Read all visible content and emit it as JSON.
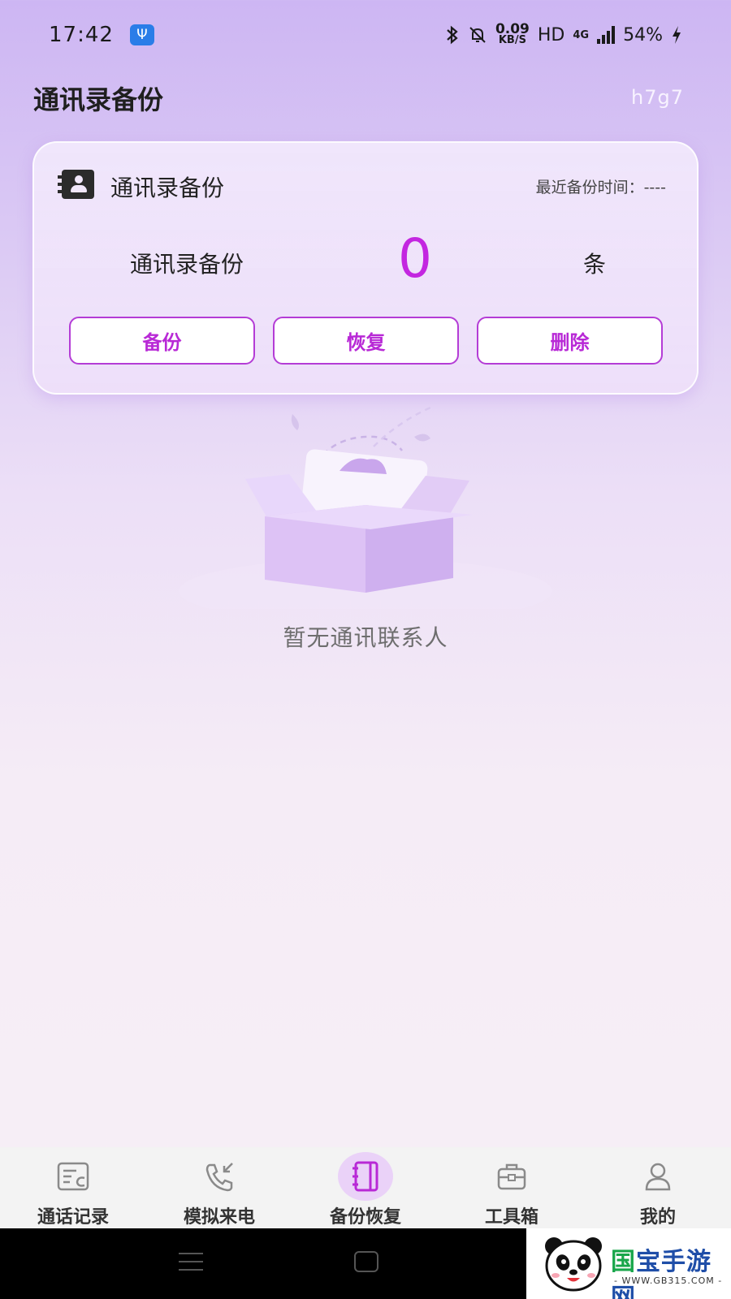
{
  "status_bar": {
    "time": "17:42",
    "usb_symbol": "Ψ",
    "speed_value": "0.09",
    "speed_unit": "KB/S",
    "hd": "HD",
    "network": "4G",
    "battery": "54%",
    "icons": [
      "usb-icon",
      "bluetooth-icon",
      "mute-bell-icon",
      "signal-icon",
      "charging-icon"
    ]
  },
  "header": {
    "title": "通讯录备份",
    "user": "h7g7"
  },
  "card": {
    "title": "通讯录备份",
    "last_backup_label": "最近备份时间：----",
    "count_label": "通讯录备份",
    "count_value": "0",
    "count_unit": "条",
    "buttons": {
      "backup": "备份",
      "restore": "恢复",
      "delete": "删除"
    }
  },
  "empty_state": {
    "text": "暂无通讯联系人"
  },
  "bottom_nav": {
    "items": [
      {
        "label": "通话记录",
        "icon": "call-log-icon"
      },
      {
        "label": "模拟来电",
        "icon": "incoming-call-icon"
      },
      {
        "label": "备份恢复",
        "icon": "backup-book-icon",
        "active": true
      },
      {
        "label": "工具箱",
        "icon": "toolbox-icon"
      },
      {
        "label": "我的",
        "icon": "user-icon"
      }
    ]
  },
  "watermark": {
    "title_accent": "国",
    "title_rest": "宝手游网",
    "url": "- WWW.GB315.COM -"
  },
  "colors": {
    "accent": "#b829d6",
    "count": "#c326e0",
    "active_nav_bg": "#ead2f8"
  }
}
